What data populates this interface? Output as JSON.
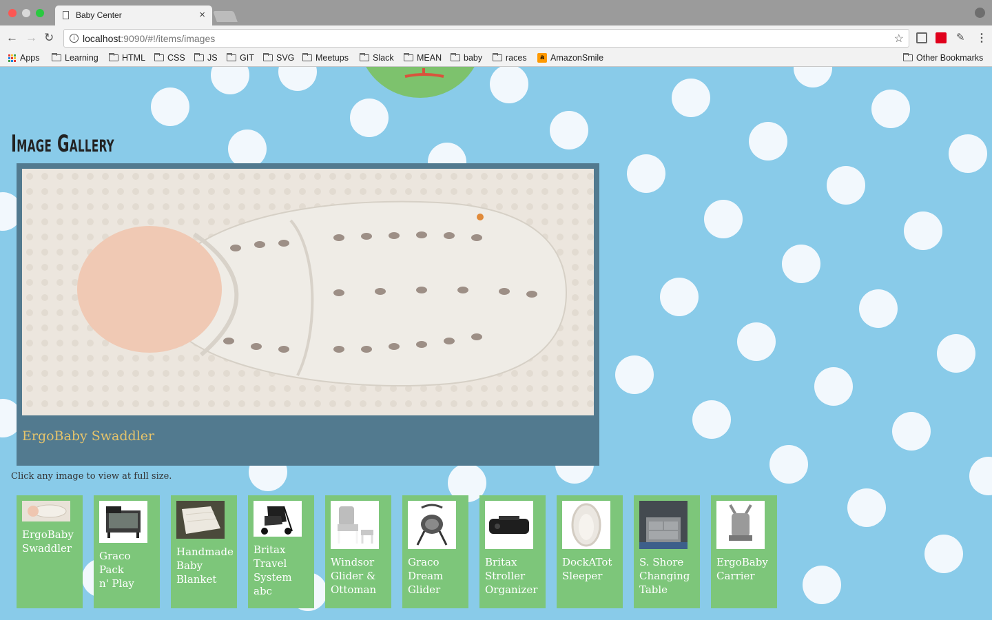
{
  "browser": {
    "tab_title": "Baby Center",
    "tab_close": "×",
    "url_host": "localhost",
    "url_path": ":9090/#!/items/images",
    "info_glyph": "i",
    "star_glyph": "☆",
    "menu_glyph": "⋮",
    "bookmarks": [
      {
        "label": "Apps",
        "icon": "apps-icon"
      },
      {
        "label": "Learning",
        "icon": "folder-icon"
      },
      {
        "label": "HTML",
        "icon": "folder-icon"
      },
      {
        "label": "CSS",
        "icon": "folder-icon"
      },
      {
        "label": "JS",
        "icon": "folder-icon"
      },
      {
        "label": "GIT",
        "icon": "folder-icon"
      },
      {
        "label": "SVG",
        "icon": "folder-icon"
      },
      {
        "label": "Meetups",
        "icon": "folder-icon"
      },
      {
        "label": "Slack",
        "icon": "folder-icon"
      },
      {
        "label": "MEAN",
        "icon": "folder-icon"
      },
      {
        "label": "baby",
        "icon": "folder-icon"
      },
      {
        "label": "races",
        "icon": "folder-icon"
      },
      {
        "label": "AmazonSmile",
        "icon": "amazon-icon"
      }
    ],
    "other_bookmarks": "Other Bookmarks",
    "amazon_glyph": "a"
  },
  "page": {
    "title": "Image Gallery",
    "viewer": {
      "caption": "ErgoBaby Swaddler",
      "image": "baby-swaddler-photo"
    },
    "hint": "Click any image to view at full size.",
    "items": [
      {
        "label_lines": [
          "ErgoBaby",
          "Swaddler"
        ],
        "image": "swaddler-thumbnail"
      },
      {
        "label_lines": [
          "Graco Pack",
          "n' Play"
        ],
        "image": "pack-n-play-thumbnail"
      },
      {
        "label_lines": [
          "Handmade",
          "Baby",
          "Blanket"
        ],
        "image": "blanket-thumbnail"
      },
      {
        "label_lines": [
          "Britax",
          "Travel",
          "System",
          "abc"
        ],
        "image": "travel-system-thumbnail"
      },
      {
        "label_lines": [
          "Windsor",
          "Glider &",
          "Ottoman"
        ],
        "image": "glider-ottoman-thumbnail"
      },
      {
        "label_lines": [
          "Graco",
          "Dream",
          "Glider"
        ],
        "image": "dream-glider-thumbnail"
      },
      {
        "label_lines": [
          "Britax",
          "Stroller",
          "Organizer"
        ],
        "image": "stroller-organizer-thumbnail"
      },
      {
        "label_lines": [
          "DockATot",
          "Sleeper"
        ],
        "image": "dockatot-thumbnail"
      },
      {
        "label_lines": [
          "S. Shore",
          "Changing",
          "Table"
        ],
        "image": "changing-table-thumbnail"
      },
      {
        "label_lines": [
          "ErgoBaby",
          "Carrier"
        ],
        "image": "carrier-thumbnail"
      }
    ]
  },
  "colors": {
    "background": "#89cbe9",
    "dots": "#f2f8fd",
    "viewer": "#527a8f",
    "caption": "#e6c46b",
    "thumb": "#7dc67a"
  }
}
